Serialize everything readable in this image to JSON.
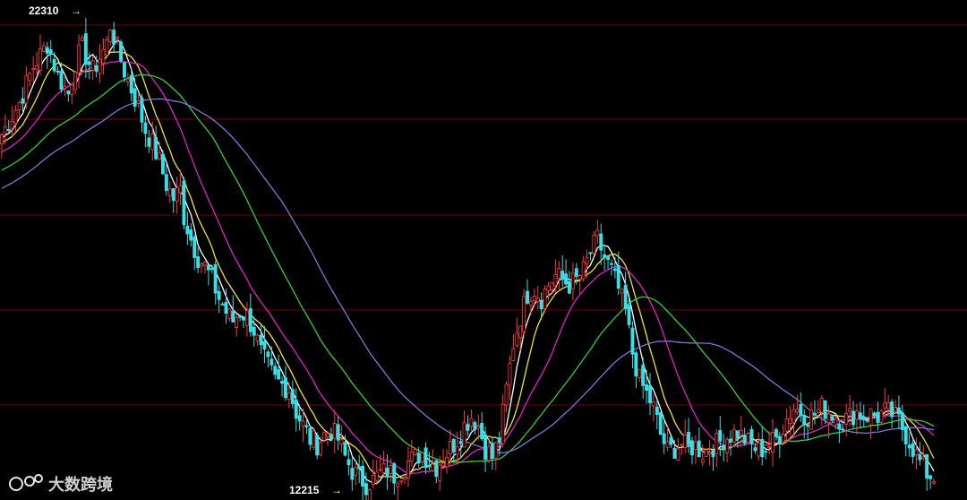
{
  "chart_data": {
    "type": "candlestick",
    "title": "",
    "grid": true,
    "ylim": [
      12215,
      22310
    ],
    "annotations": {
      "high_label": "22310",
      "low_label": "12215"
    },
    "watermark": "大数跨境",
    "colors": {
      "background": "#000000",
      "grid": "#7a0000",
      "up": "#ff3b3b",
      "down": "#37e0e6",
      "ma_white": "#ffffff",
      "ma_yellow": "#f2e23a",
      "ma_magenta": "#e020c8",
      "ma_green": "#2fd12f",
      "ma_blue": "#7a78d8"
    },
    "close_path": [
      [
        0,
        19900
      ],
      [
        5,
        20600
      ],
      [
        9,
        21400
      ],
      [
        13,
        21900
      ],
      [
        16,
        21200
      ],
      [
        19,
        20800
      ],
      [
        21,
        21500
      ],
      [
        23,
        21800
      ],
      [
        26,
        21300
      ],
      [
        28,
        21600
      ],
      [
        30,
        21900
      ],
      [
        31,
        22310
      ],
      [
        33,
        21800
      ],
      [
        35,
        21300
      ],
      [
        37,
        20900
      ],
      [
        39,
        20500
      ],
      [
        41,
        20000
      ],
      [
        43,
        19700
      ],
      [
        45,
        19300
      ],
      [
        47,
        18800
      ],
      [
        49,
        18500
      ],
      [
        51,
        18700
      ],
      [
        52,
        18100
      ],
      [
        54,
        17600
      ],
      [
        56,
        17200
      ],
      [
        58,
        17000
      ],
      [
        60,
        16700
      ],
      [
        62,
        16300
      ],
      [
        64,
        16000
      ],
      [
        66,
        15800
      ],
      [
        68,
        16000
      ],
      [
        70,
        15900
      ],
      [
        72,
        15600
      ],
      [
        74,
        15100
      ],
      [
        76,
        14800
      ],
      [
        78,
        14500
      ],
      [
        80,
        14400
      ],
      [
        82,
        14300
      ],
      [
        84,
        13800
      ],
      [
        86,
        13500
      ],
      [
        88,
        13200
      ],
      [
        90,
        13100
      ],
      [
        92,
        13300
      ],
      [
        94,
        13400
      ],
      [
        96,
        13200
      ],
      [
        98,
        12800
      ],
      [
        100,
        12500
      ],
      [
        102,
        12350
      ],
      [
        104,
        12215
      ],
      [
        106,
        12300
      ],
      [
        108,
        12450
      ],
      [
        110,
        12500
      ],
      [
        112,
        12400
      ],
      [
        114,
        12500
      ],
      [
        116,
        12700
      ],
      [
        118,
        12800
      ],
      [
        120,
        12900
      ],
      [
        122,
        12700
      ],
      [
        124,
        12600
      ],
      [
        126,
        12800
      ],
      [
        128,
        13000
      ],
      [
        130,
        13200
      ],
      [
        132,
        13500
      ],
      [
        134,
        13700
      ],
      [
        136,
        13500
      ],
      [
        138,
        13000
      ],
      [
        140,
        12800
      ],
      [
        142,
        13200
      ],
      [
        144,
        14300
      ],
      [
        146,
        15300
      ],
      [
        148,
        15900
      ],
      [
        150,
        16400
      ],
      [
        152,
        16500
      ],
      [
        154,
        16300
      ],
      [
        156,
        16600
      ],
      [
        158,
        16800
      ],
      [
        160,
        16700
      ],
      [
        162,
        16600
      ],
      [
        164,
        16700
      ],
      [
        166,
        16900
      ],
      [
        168,
        17300
      ],
      [
        170,
        17600
      ],
      [
        172,
        17200
      ],
      [
        174,
        16900
      ],
      [
        176,
        16500
      ],
      [
        178,
        16000
      ],
      [
        180,
        15100
      ],
      [
        182,
        14500
      ],
      [
        184,
        14200
      ],
      [
        186,
        13900
      ],
      [
        188,
        13300
      ],
      [
        190,
        12950
      ],
      [
        192,
        13000
      ],
      [
        194,
        13100
      ],
      [
        196,
        13000
      ],
      [
        198,
        13050
      ],
      [
        200,
        12900
      ],
      [
        202,
        13000
      ],
      [
        204,
        13100
      ],
      [
        206,
        13200
      ],
      [
        208,
        13300
      ],
      [
        210,
        13350
      ],
      [
        212,
        13200
      ],
      [
        214,
        13050
      ],
      [
        216,
        12950
      ],
      [
        218,
        13000
      ],
      [
        220,
        13150
      ],
      [
        222,
        13300
      ],
      [
        224,
        13650
      ],
      [
        226,
        13900
      ],
      [
        228,
        13800
      ],
      [
        230,
        13700
      ],
      [
        232,
        13750
      ],
      [
        234,
        13900
      ],
      [
        236,
        13800
      ],
      [
        238,
        13700
      ],
      [
        240,
        13600
      ],
      [
        242,
        13700
      ],
      [
        244,
        13800
      ],
      [
        246,
        13700
      ],
      [
        248,
        13750
      ],
      [
        250,
        13700
      ],
      [
        252,
        13800
      ],
      [
        254,
        13750
      ],
      [
        256,
        13600
      ],
      [
        258,
        13300
      ],
      [
        260,
        13000
      ],
      [
        262,
        12700
      ],
      [
        264,
        12450
      ],
      [
        266,
        12350
      ]
    ],
    "moving_averages": [
      {
        "color_key": "ma_white",
        "period": 5
      },
      {
        "color_key": "ma_yellow",
        "period": 10
      },
      {
        "color_key": "ma_magenta",
        "period": 20
      },
      {
        "color_key": "ma_green",
        "period": 40
      },
      {
        "color_key": "ma_blue",
        "period": 60
      }
    ]
  }
}
